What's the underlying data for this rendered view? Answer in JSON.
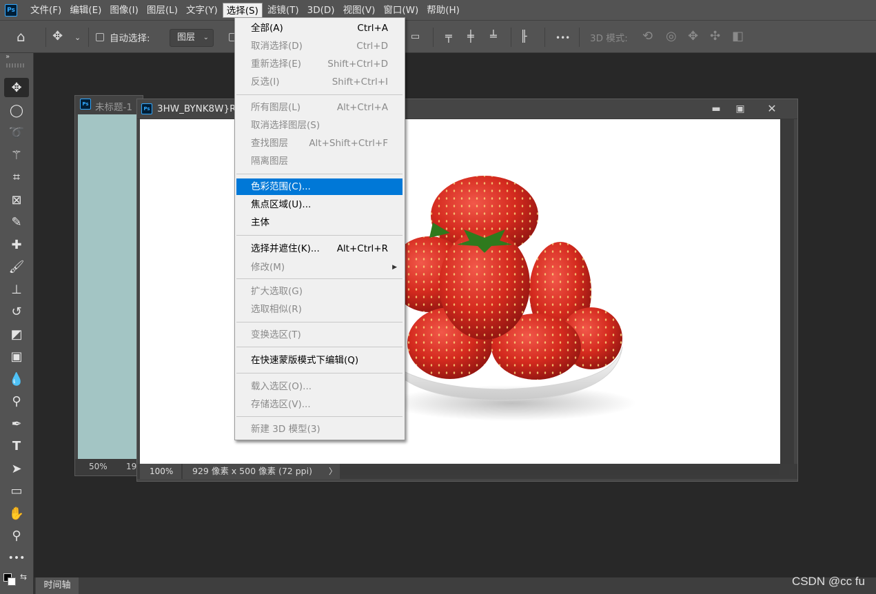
{
  "app": {
    "logo": "Ps"
  },
  "menubar": [
    "文件(F)",
    "编辑(E)",
    "图像(I)",
    "图层(L)",
    "文字(Y)",
    "选择(S)",
    "滤镜(T)",
    "3D(D)",
    "视图(V)",
    "窗口(W)",
    "帮助(H)"
  ],
  "optionsbar": {
    "auto_select_label": "自动选择:",
    "auto_select_value": "图层",
    "mode_3d_label": "3D 模式:",
    "more_label": "•••"
  },
  "documents": {
    "back": {
      "title": "未标题-1",
      "zoom": "50%",
      "info_fragment": "19",
      "canvas_color": "#a3c5c4"
    },
    "front": {
      "title": "3HW_BYNK8W}R",
      "zoom": "100%",
      "info": "929 像素 x 500 像素 (72 ppi)",
      "arrow": "〉"
    }
  },
  "select_menu": [
    {
      "label": "全部(A)",
      "shortcut": "Ctrl+A",
      "disabled": false
    },
    {
      "label": "取消选择(D)",
      "shortcut": "Ctrl+D",
      "disabled": true
    },
    {
      "label": "重新选择(E)",
      "shortcut": "Shift+Ctrl+D",
      "disabled": true
    },
    {
      "label": "反选(I)",
      "shortcut": "Shift+Ctrl+I",
      "disabled": true
    },
    {
      "label": "所有图层(L)",
      "shortcut": "Alt+Ctrl+A",
      "disabled": true
    },
    {
      "label": "取消选择图层(S)",
      "shortcut": "",
      "disabled": true
    },
    {
      "label": "查找图层",
      "shortcut": "Alt+Shift+Ctrl+F",
      "disabled": true
    },
    {
      "label": "隔离图层",
      "shortcut": "",
      "disabled": true
    },
    {
      "label": "色彩范围(C)...",
      "shortcut": "",
      "disabled": false,
      "highlight": true
    },
    {
      "label": "焦点区域(U)...",
      "shortcut": "",
      "disabled": false
    },
    {
      "label": "主体",
      "shortcut": "",
      "disabled": false
    },
    {
      "label": "选择并遮住(K)...",
      "shortcut": "Alt+Ctrl+R",
      "disabled": false
    },
    {
      "label": "修改(M)",
      "shortcut": "",
      "disabled": true,
      "submenu": true
    },
    {
      "label": "扩大选取(G)",
      "shortcut": "",
      "disabled": true
    },
    {
      "label": "选取相似(R)",
      "shortcut": "",
      "disabled": true
    },
    {
      "label": "变换选区(T)",
      "shortcut": "",
      "disabled": true
    },
    {
      "label": "在快速蒙版模式下编辑(Q)",
      "shortcut": "",
      "disabled": false
    },
    {
      "label": "载入选区(O)...",
      "shortcut": "",
      "disabled": true
    },
    {
      "label": "存储选区(V)...",
      "shortcut": "",
      "disabled": true
    },
    {
      "label": "新建 3D 模型(3)",
      "shortcut": "",
      "disabled": true
    }
  ],
  "tools": [
    "move-tool-icon",
    "elliptical-marquee-icon",
    "lasso-icon",
    "magic-wand-icon",
    "crop-icon",
    "frame-icon",
    "eyedropper-icon",
    "healing-brush-icon",
    "brush-icon",
    "clone-stamp-icon",
    "history-brush-icon",
    "eraser-icon",
    "gradient-icon",
    "blur-icon",
    "dodge-icon",
    "pen-icon",
    "type-icon",
    "path-selection-icon",
    "rectangle-icon",
    "hand-icon",
    "zoom-icon",
    "more-tools-icon"
  ],
  "timeline_tab": "时间轴",
  "watermark": "CSDN @cc fu",
  "colors": {
    "highlight": "#0078d7",
    "menubar": "#535353",
    "workspace": "#282828"
  }
}
